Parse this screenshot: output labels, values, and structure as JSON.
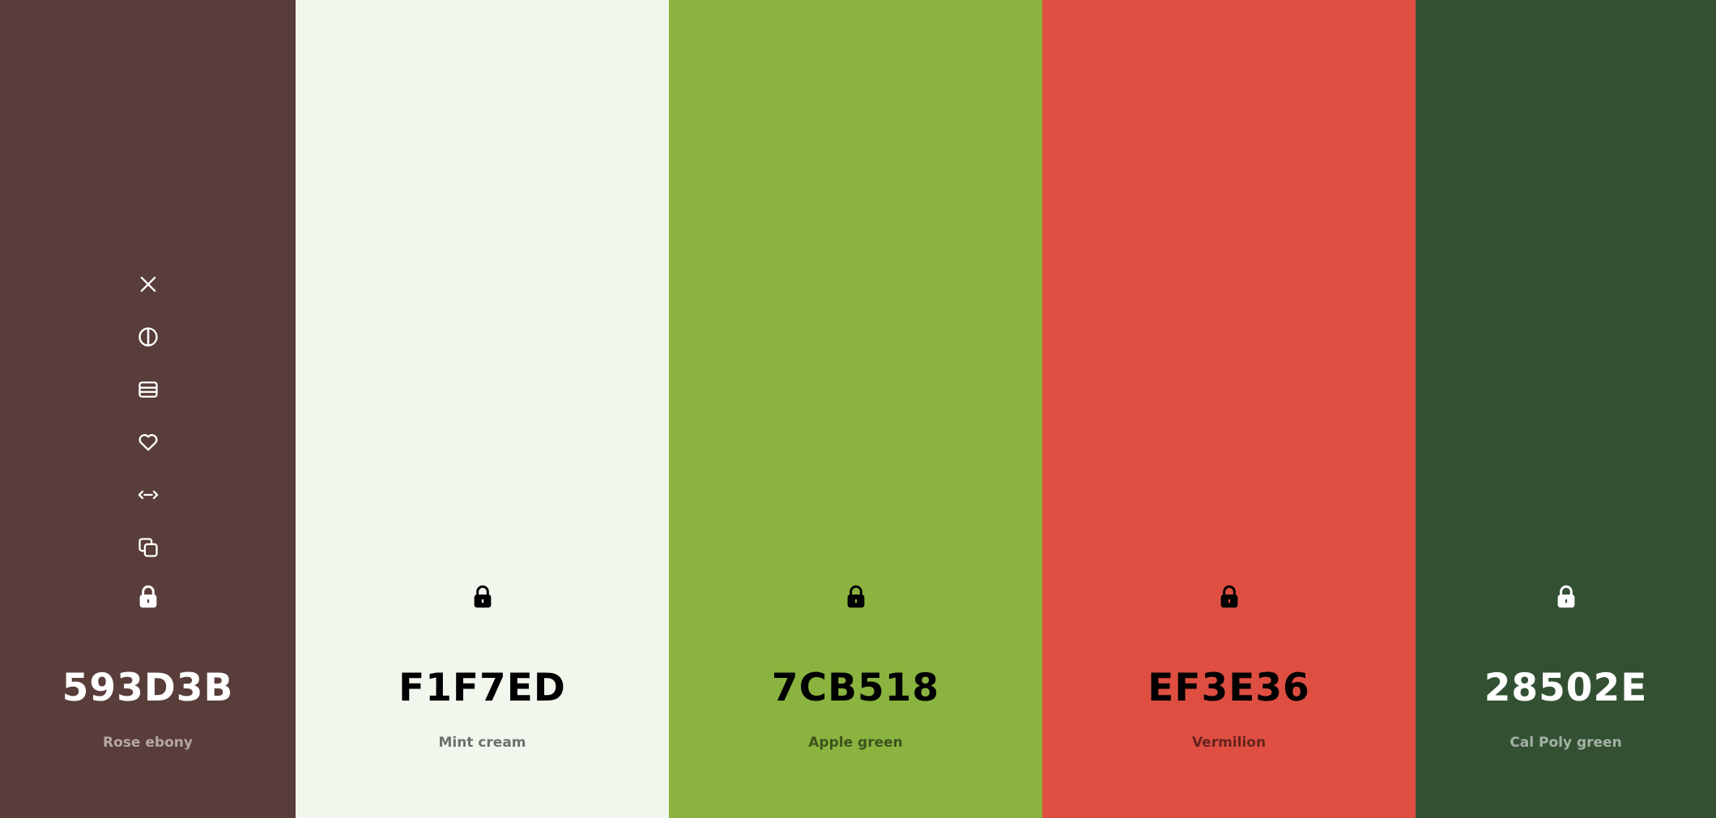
{
  "swatches": [
    {
      "hex": "593D3B",
      "name": "Rose ebony",
      "bg": "#593D3B",
      "fg": "#FFFFFF",
      "subtle": "rgba(255,255,255,0.55)",
      "show_tools": true,
      "lock_icon": "lock-icon"
    },
    {
      "hex": "F1F7ED",
      "name": "Mint cream",
      "bg": "#F1F7ED",
      "fg": "#000000",
      "subtle": "rgba(0,0,0,0.55)",
      "show_tools": false,
      "lock_icon": "lock-icon"
    },
    {
      "hex": "7CB518",
      "name": "Apple green",
      "bg": "#8AB43F",
      "fg": "#000000",
      "subtle": "rgba(0,0,0,0.55)",
      "show_tools": false,
      "lock_icon": "lock-icon"
    },
    {
      "hex": "EF3E36",
      "name": "Vermilion",
      "bg": "#DF4F41",
      "fg": "#000000",
      "subtle": "rgba(0,0,0,0.55)",
      "show_tools": false,
      "lock_icon": "lock-icon"
    },
    {
      "hex": "28502E",
      "name": "Cal Poly green",
      "bg": "#335033",
      "fg": "#FFFFFF",
      "subtle": "rgba(255,255,255,0.55)",
      "show_tools": false,
      "lock_icon": "lock-icon"
    }
  ],
  "tools": [
    {
      "icon": "close-icon",
      "action": "remove"
    },
    {
      "icon": "contrast-icon",
      "action": "shades"
    },
    {
      "icon": "layers-icon",
      "action": "view"
    },
    {
      "icon": "heart-icon",
      "action": "save"
    },
    {
      "icon": "drag-arrows-icon",
      "action": "drag"
    },
    {
      "icon": "copy-icon",
      "action": "copy"
    }
  ]
}
